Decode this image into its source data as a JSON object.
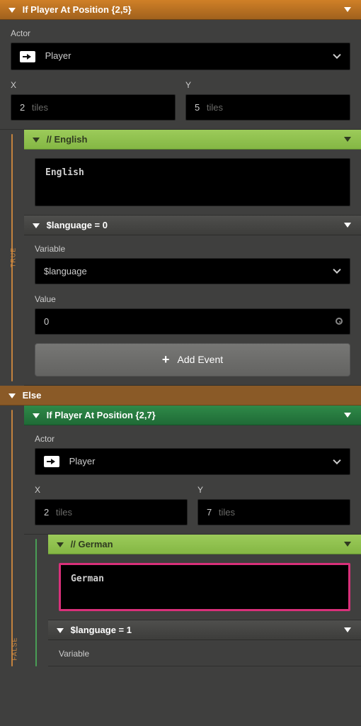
{
  "outer": {
    "title": "If Player At Position {2,5}",
    "actor_label": "Actor",
    "actor_value": "Player",
    "x_label": "X",
    "y_label": "Y",
    "x_value": "2",
    "y_value": "5",
    "unit": "tiles",
    "true_label": "TRUE",
    "else_label": "Else",
    "false_label": "FALSE"
  },
  "english": {
    "title": "// English",
    "text": "English"
  },
  "setlang0": {
    "title": "$language = 0",
    "variable_label": "Variable",
    "variable_value": "$language",
    "value_label": "Value",
    "value_value": "0"
  },
  "add_event": "Add Event",
  "inner_if": {
    "title": "If Player At Position {2,7}",
    "actor_label": "Actor",
    "actor_value": "Player",
    "x_label": "X",
    "y_label": "Y",
    "x_value": "2",
    "y_value": "7",
    "unit": "tiles"
  },
  "german": {
    "title": "// German",
    "text": "German"
  },
  "setlang1": {
    "title": "$language = 1",
    "variable_label": "Variable"
  }
}
